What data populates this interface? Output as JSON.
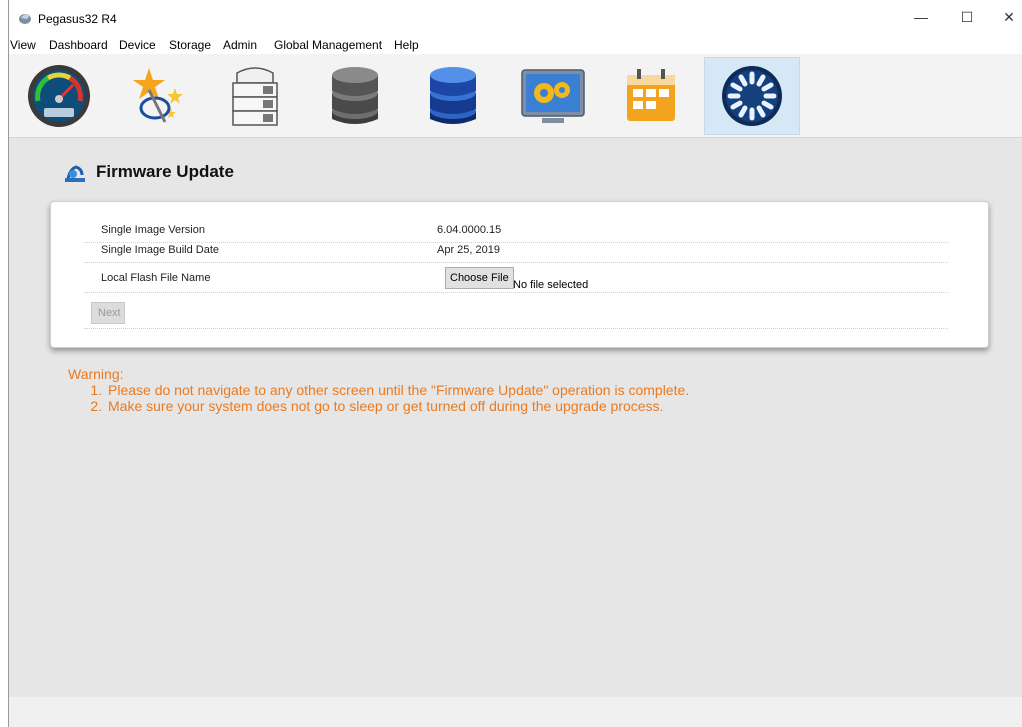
{
  "window": {
    "title": "Pegasus32 R4",
    "minimize": "—",
    "maximize": "☐",
    "close": "✕"
  },
  "menu": [
    "View",
    "Dashboard",
    "Device",
    "Storage",
    "Admin",
    "Global Management",
    "Help"
  ],
  "toolbar": {
    "items": [
      {
        "name": "dashboard-gauge",
        "active": false
      },
      {
        "name": "wizard",
        "active": false
      },
      {
        "name": "device-enclosure",
        "active": false
      },
      {
        "name": "storage-gray",
        "active": false
      },
      {
        "name": "storage-blue",
        "active": false
      },
      {
        "name": "settings-gears",
        "active": false
      },
      {
        "name": "calendar",
        "active": false
      },
      {
        "name": "firmware-update",
        "active": true
      }
    ]
  },
  "page": {
    "title": "Firmware Update"
  },
  "firmware": {
    "rows": [
      {
        "label": "Single Image Version",
        "value": "6.04.0000.15"
      },
      {
        "label": "Single Image Build Date",
        "value": "Apr 25, 2019"
      },
      {
        "label": "Local Flash File Name",
        "value": ""
      }
    ],
    "choose_file_label": "Choose File",
    "no_file_text": "No file selected",
    "next_label": "Next"
  },
  "warning": {
    "heading": "Warning:",
    "items": [
      "Please do not navigate to any other screen until the \"Firmware Update\" operation is complete.",
      "Make sure your system does not go to sleep or get turned off during the upgrade process."
    ]
  },
  "colors": {
    "warning": "#ea7a20",
    "toolbar_bg": "#f3f3f3",
    "content_bg": "#e6e6e6",
    "active_tool_bg": "#d6e7f5"
  }
}
